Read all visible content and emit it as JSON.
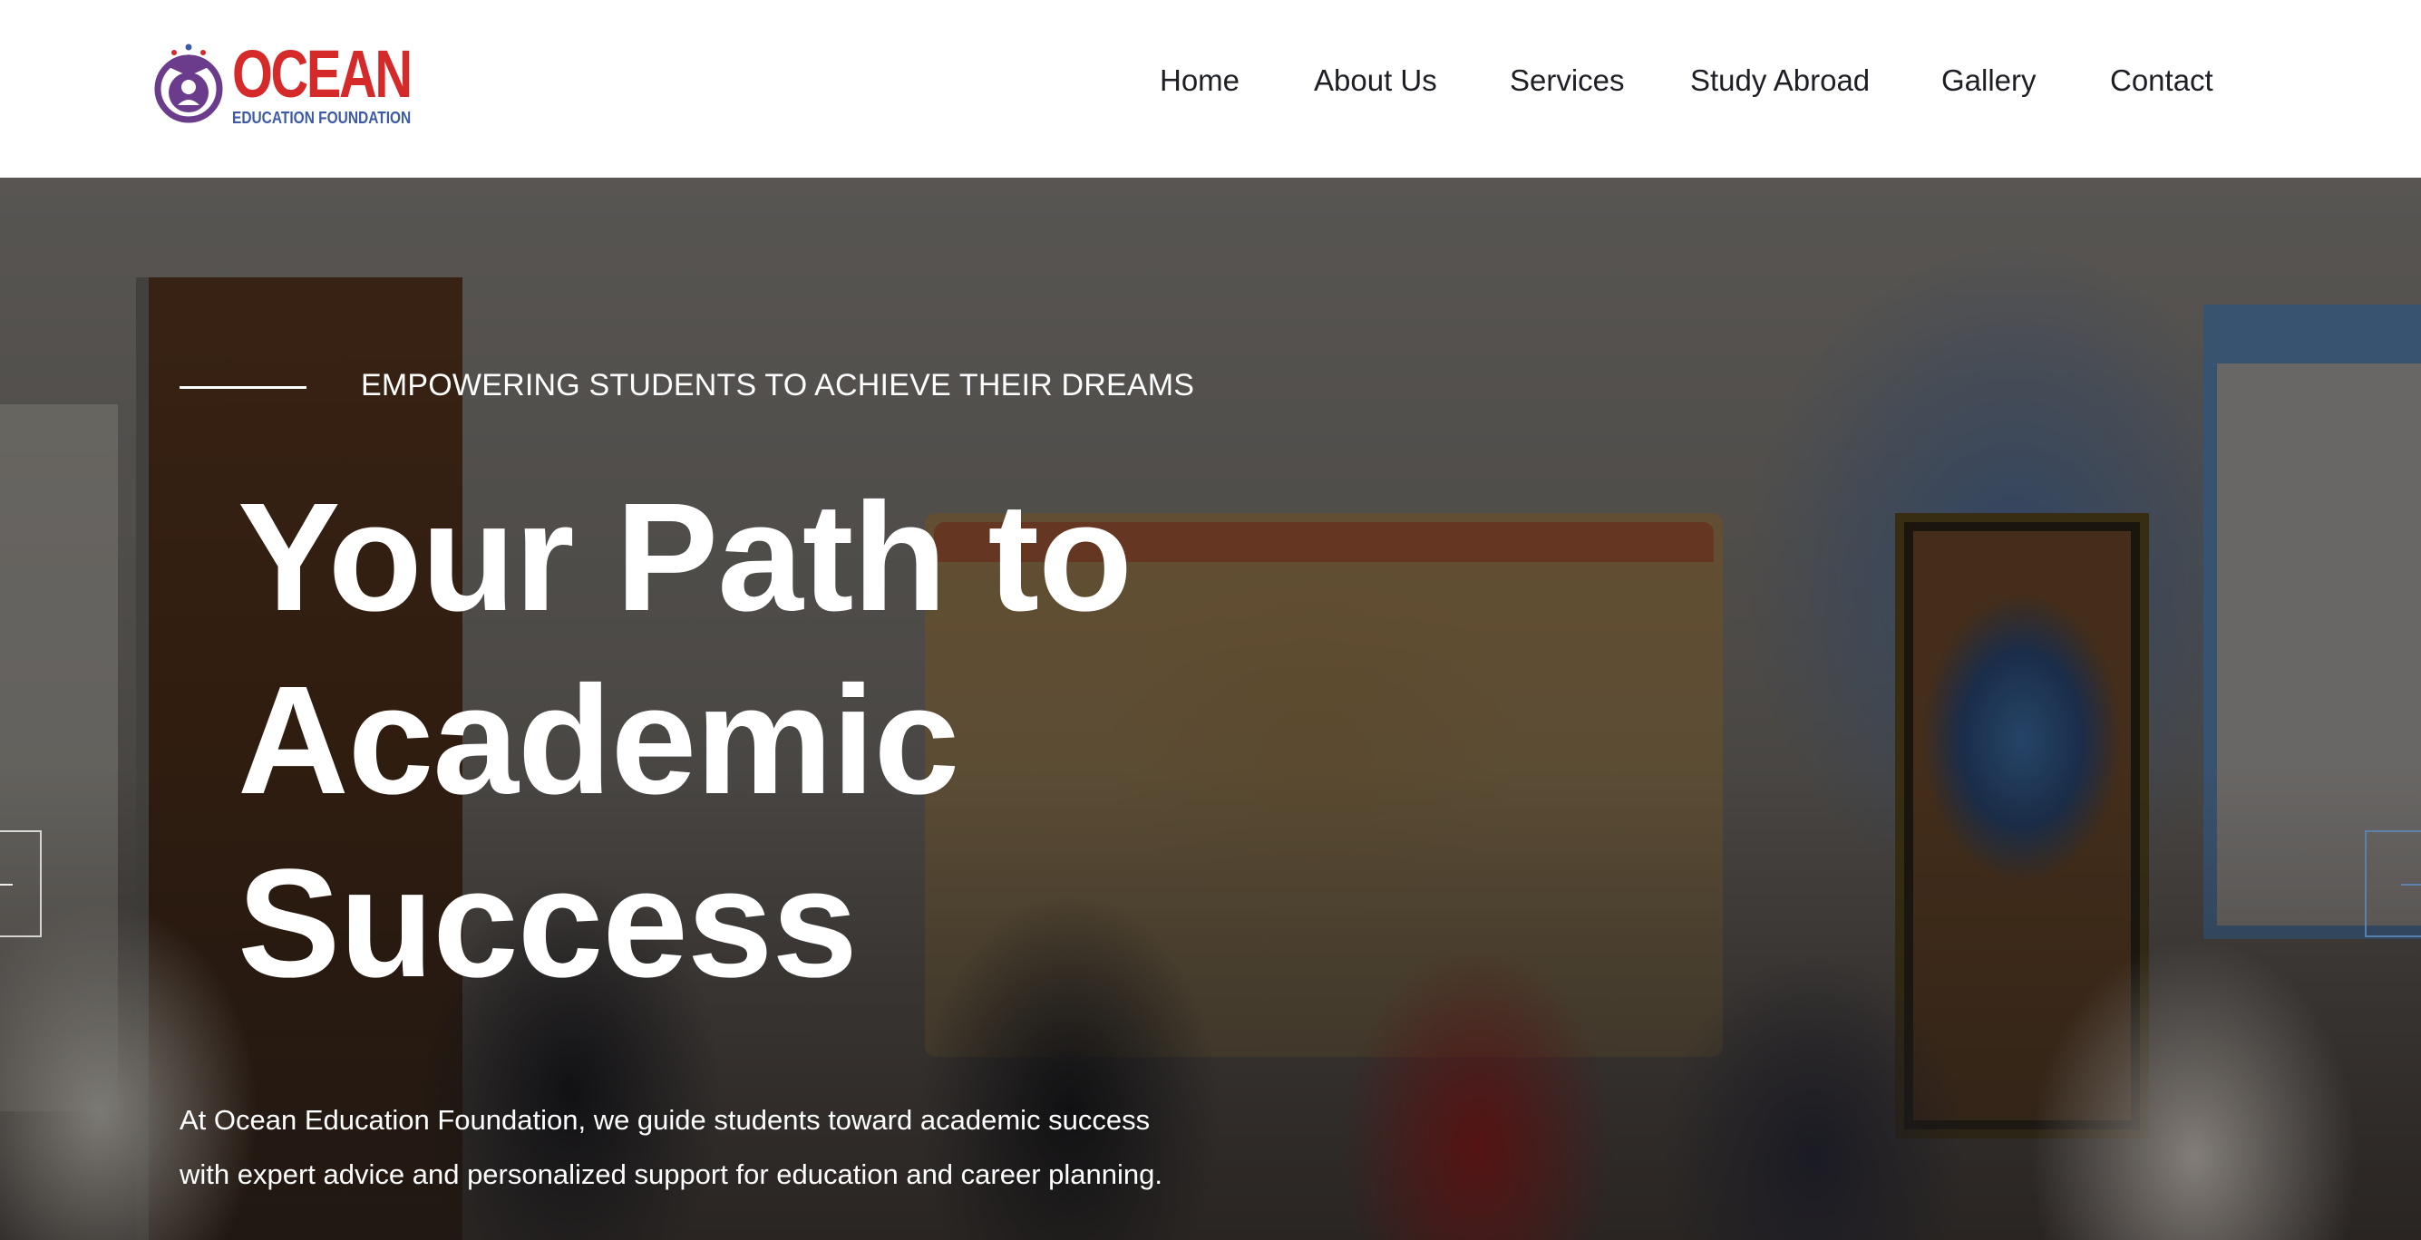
{
  "logo": {
    "wordmark": "OCEAN",
    "subtitle": "EDUCATION FOUNDATION",
    "colors": {
      "wordmark": "#d62a2a",
      "subtitle": "#3c5aa6",
      "emblem": "#6b3c8c"
    }
  },
  "nav": {
    "items": [
      {
        "label": "Home"
      },
      {
        "label": "About Us"
      },
      {
        "label": "Services"
      },
      {
        "label": "Study Abroad"
      },
      {
        "label": "Gallery"
      },
      {
        "label": "Contact"
      }
    ]
  },
  "hero": {
    "tagline": "EMPOWERING STUDENTS TO ACHIEVE THEIR DREAMS",
    "headline": [
      "Your Path to",
      "Academic",
      "Success"
    ],
    "description": [
      "At Ocean Education Foundation, we guide students toward academic success",
      "with expert advice and personalized support for education and career planning."
    ],
    "slider": {
      "prev_icon": "arrow-left-icon",
      "next_icon": "arrow-right-icon"
    }
  }
}
